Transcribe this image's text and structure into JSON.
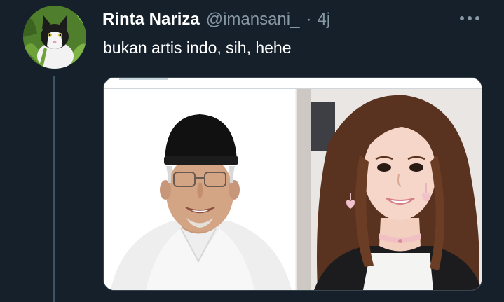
{
  "tweet": {
    "display_name": "Rinta Nariza",
    "handle": "@imansani_",
    "separator": "·",
    "time": "4j",
    "text": "bukan artis indo, sih, hehe",
    "more_icon": "more-horizontal-icon"
  },
  "colors": {
    "background": "#15202b",
    "secondary_text": "#8899a6",
    "thread_line": "#3d5466"
  }
}
